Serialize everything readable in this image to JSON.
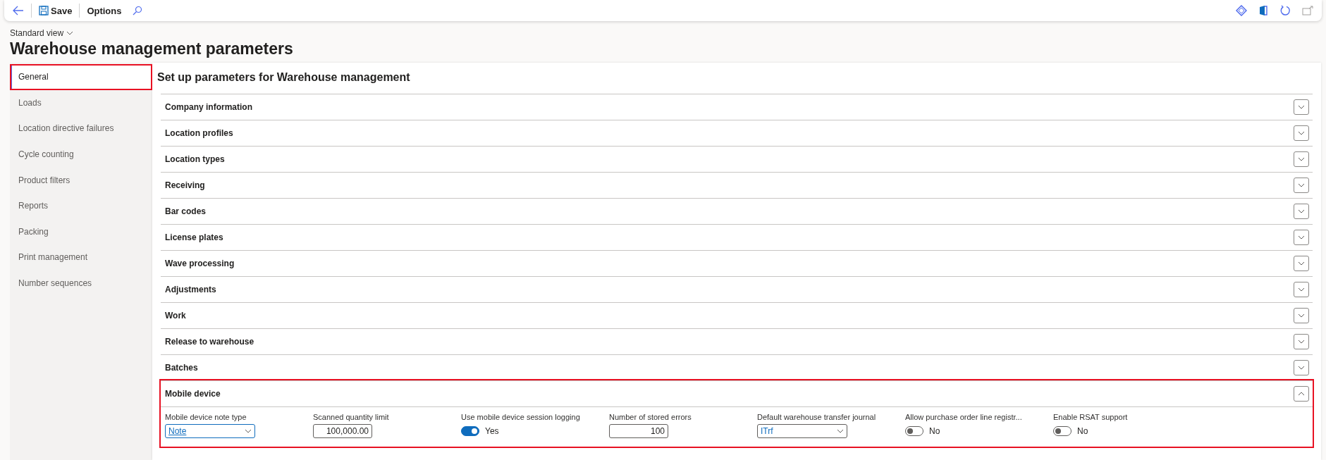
{
  "toolbar": {
    "save": "Save",
    "options": "Options"
  },
  "view_selector": "Standard view",
  "title": "Warehouse management parameters",
  "sidebar": {
    "items": [
      {
        "label": "General",
        "selected": true,
        "highlighted": true
      },
      {
        "label": "Loads",
        "selected": false,
        "highlighted": false
      },
      {
        "label": "Location directive failures",
        "selected": false,
        "highlighted": false
      },
      {
        "label": "Cycle counting",
        "selected": false,
        "highlighted": false
      },
      {
        "label": "Product filters",
        "selected": false,
        "highlighted": false
      },
      {
        "label": "Reports",
        "selected": false,
        "highlighted": false
      },
      {
        "label": "Packing",
        "selected": false,
        "highlighted": false
      },
      {
        "label": "Print management",
        "selected": false,
        "highlighted": false
      },
      {
        "label": "Number sequences",
        "selected": false,
        "highlighted": false
      }
    ]
  },
  "panel": {
    "heading": "Set up parameters for Warehouse management",
    "sections": [
      {
        "label": "Company information",
        "expanded": false,
        "highlighted": false
      },
      {
        "label": "Location profiles",
        "expanded": false,
        "highlighted": false
      },
      {
        "label": "Location types",
        "expanded": false,
        "highlighted": false
      },
      {
        "label": "Receiving",
        "expanded": false,
        "highlighted": false
      },
      {
        "label": "Bar codes",
        "expanded": false,
        "highlighted": false
      },
      {
        "label": "License plates",
        "expanded": false,
        "highlighted": false
      },
      {
        "label": "Wave processing",
        "expanded": false,
        "highlighted": false
      },
      {
        "label": "Adjustments",
        "expanded": false,
        "highlighted": false
      },
      {
        "label": "Work",
        "expanded": false,
        "highlighted": false
      },
      {
        "label": "Release to warehouse",
        "expanded": false,
        "highlighted": false
      },
      {
        "label": "Batches",
        "expanded": false,
        "highlighted": false
      },
      {
        "label": "Mobile device",
        "expanded": true,
        "highlighted": true,
        "fields": [
          {
            "kind": "dropdown",
            "label": "Mobile device note type",
            "value": "Note",
            "focused": true
          },
          {
            "kind": "number",
            "label": "Scanned quantity limit",
            "value": "100,000.00"
          },
          {
            "kind": "toggle",
            "label": "Use mobile device session logging",
            "on": true,
            "value": "Yes"
          },
          {
            "kind": "number",
            "label": "Number of stored errors",
            "value": "100"
          },
          {
            "kind": "dropdown",
            "label": "Default warehouse transfer journal",
            "value": "ITrf",
            "focused": false
          },
          {
            "kind": "toggle",
            "label": "Allow purchase order line registr...",
            "on": false,
            "value": "No"
          },
          {
            "kind": "toggle",
            "label": "Enable RSAT support",
            "on": false,
            "value": "No"
          }
        ]
      }
    ]
  }
}
